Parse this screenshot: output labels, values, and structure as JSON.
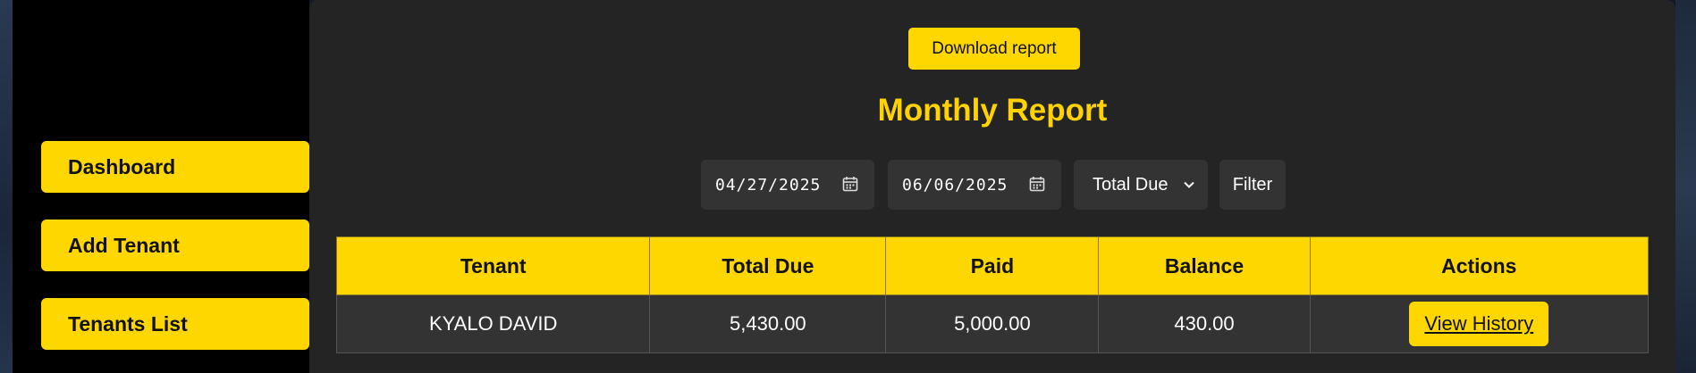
{
  "sidebar": {
    "items": [
      {
        "label": "Dashboard"
      },
      {
        "label": "Add Tenant"
      },
      {
        "label": "Tenants List"
      }
    ]
  },
  "main": {
    "download_label": "Download report",
    "title": "Monthly Report",
    "filters": {
      "start_date": "04/27/2025",
      "end_date": "06/06/2025",
      "sort_selected": "Total Due",
      "filter_label": "Filter"
    },
    "table": {
      "headers": [
        "Tenant",
        "Total Due",
        "Paid",
        "Balance",
        "Actions"
      ],
      "rows": [
        {
          "tenant": "KYALO DAVID",
          "total_due": "5,430.00",
          "paid": "5,000.00",
          "balance": "430.00",
          "action_label": "View History"
        }
      ]
    }
  },
  "colors": {
    "accent": "#ffd700",
    "title": "#ffd200",
    "panel": "#242424",
    "field": "#333333"
  },
  "icons": [
    "calendar-icon",
    "chevron-down-icon"
  ]
}
